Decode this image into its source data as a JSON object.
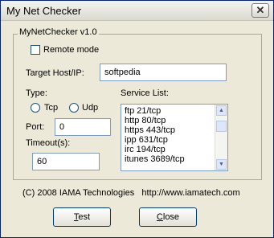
{
  "window": {
    "title": "My Net Checker",
    "close_glyph": "✕"
  },
  "group": {
    "title": "MyNetChecker v1.0"
  },
  "remote_mode": {
    "label": "Remote mode",
    "checked": false
  },
  "target": {
    "label": "Target Host/IP:",
    "value": "softpedia"
  },
  "type": {
    "label": "Type:",
    "tcp_label": "Tcp",
    "udp_label": "Udp"
  },
  "port": {
    "label": "Port:",
    "value": "0"
  },
  "timeout": {
    "label": "Timeout(s):",
    "value": "60"
  },
  "service_list": {
    "label": "Service List:",
    "items": [
      "ftp  21/tcp",
      "http  80/tcp",
      "https  443/tcp",
      "ipp  631/tcp",
      "irc  194/tcp",
      "itunes  3689/tcp"
    ]
  },
  "footer": {
    "copyright": "(C) 2008 IAMA Technologies",
    "url": "http://www.iamatech.com"
  },
  "buttons": {
    "test_first": "T",
    "test_rest": "est",
    "close_first": "C",
    "close_rest": "lose"
  }
}
